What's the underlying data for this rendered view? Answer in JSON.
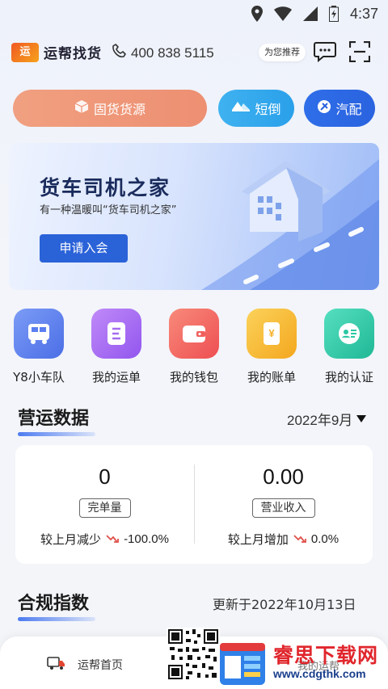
{
  "status_bar": {
    "time": "4:37"
  },
  "header": {
    "logo_text": "运帮找货",
    "logo_mark": "运",
    "hotline": "400 838 5115",
    "recommend_label": "为您推荐"
  },
  "quick_actions": [
    {
      "label": "固货货源"
    },
    {
      "label": "短倒"
    },
    {
      "label": "汽配"
    }
  ],
  "banner": {
    "title": "货车司机之家",
    "subtitle": "有一种温暖叫“货车司机之家”",
    "button_label": "申请入会"
  },
  "menu": [
    {
      "label": "Y8小车队",
      "icon": "truck-fleet-icon",
      "color": "#5b7ef0"
    },
    {
      "label": "我的运单",
      "icon": "waybill-icon",
      "color": "#a46cf0"
    },
    {
      "label": "我的钱包",
      "icon": "wallet-icon",
      "color": "#f0605c"
    },
    {
      "label": "我的账单",
      "icon": "bill-icon",
      "color": "#f6b22c"
    },
    {
      "label": "我的认证",
      "icon": "id-card-icon",
      "color": "#2cc7a4"
    }
  ],
  "operations": {
    "title": "营运数据",
    "month": "2022年9月",
    "stats": [
      {
        "value": "0",
        "tag": "完单量",
        "compare": "较上月减少",
        "pct": "-100.0%"
      },
      {
        "value": "0.00",
        "tag": "营业收入",
        "compare": "较上月增加",
        "pct": "0.0%"
      }
    ]
  },
  "compliance": {
    "title": "合规指数",
    "updated": "更新于2022年10月13日"
  },
  "bottom_nav": {
    "home_label": "运帮首页",
    "mine_label": "我的运帮"
  },
  "watermark": {
    "name": "睿思下载网",
    "url": "www.cdgthk.com"
  }
}
